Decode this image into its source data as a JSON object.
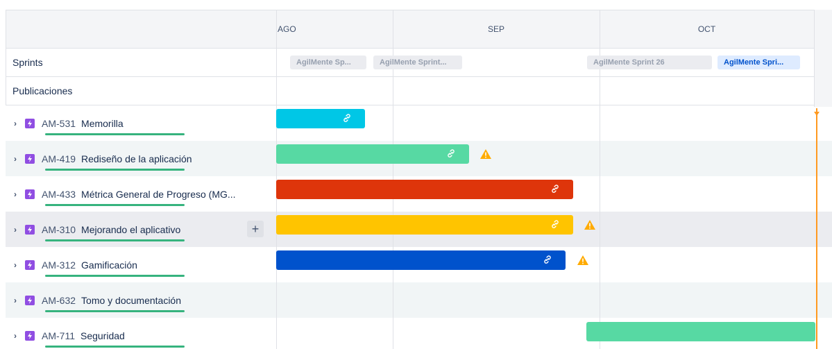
{
  "months": [
    {
      "label": "AGO"
    },
    {
      "label": "SEP"
    },
    {
      "label": "OCT"
    }
  ],
  "rows": {
    "sprints_label": "Sprints",
    "releases_label": "Publicaciones"
  },
  "sprints": [
    {
      "label": "AgilMente Sp...",
      "active": false
    },
    {
      "label": "AgilMente Sprint...",
      "active": false
    },
    {
      "label": "AgilMente Sprint 26",
      "active": false
    },
    {
      "label": "AgilMente Spri...",
      "active": true
    }
  ],
  "epics": [
    {
      "key": "AM-531",
      "title": "Memorilla",
      "bar_color": "#00c7e6",
      "warning": false
    },
    {
      "key": "AM-419",
      "title": "Rediseño de la aplicación",
      "bar_color": "#57d9a3",
      "warning": true
    },
    {
      "key": "AM-433",
      "title": "Métrica General de Progreso (MG...",
      "bar_color": "#de350b",
      "warning": false
    },
    {
      "key": "AM-310",
      "title": "Mejorando el aplicativo",
      "bar_color": "#ffc400",
      "warning": true,
      "add_label": "+"
    },
    {
      "key": "AM-312",
      "title": "Gamificación",
      "bar_color": "#0052cc",
      "warning": true
    },
    {
      "key": "AM-632",
      "title": "Tomo y documentación",
      "bar_color": null,
      "warning": false
    },
    {
      "key": "AM-711",
      "title": "Seguridad",
      "bar_color": "#57d9a3",
      "warning": false
    }
  ],
  "colors": {
    "epic_icon": "#904ee2",
    "progress": "#36b37e",
    "today_marker": "#ff991f",
    "warning": "#ffab00"
  }
}
